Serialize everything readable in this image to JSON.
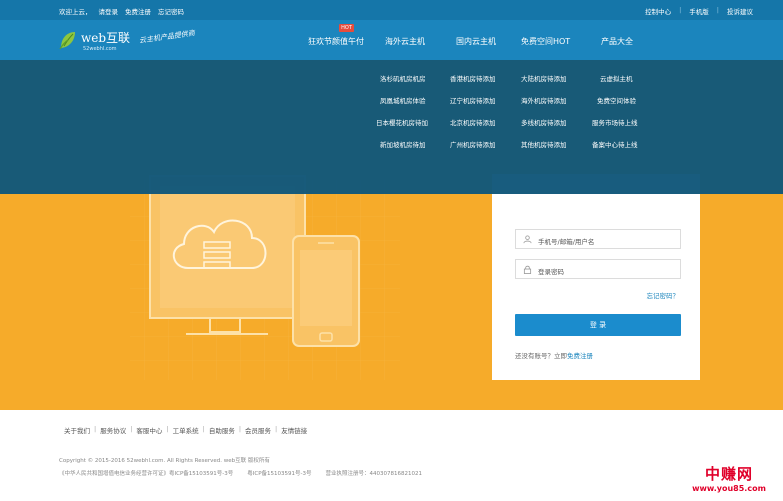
{
  "topbar": {
    "left_items": [
      "欢迎上云，",
      "请登录",
      "免费注册",
      "忘记密码"
    ],
    "right_items": [
      "控制中心",
      "手机版",
      "投诉建议"
    ]
  },
  "header": {
    "logo_main": "web互联",
    "logo_sub": "52webhl.com",
    "slogan": "云主机产品提供商",
    "nav": [
      {
        "label": "狂欢节颜值午付",
        "badge": "HOT"
      },
      {
        "label": "海外云主机"
      },
      {
        "label": "国内云主机"
      },
      {
        "label": "免费空间HOT"
      },
      {
        "label": "产品大全"
      }
    ]
  },
  "dropdown": {
    "col1": [
      "洛杉矶机房机房",
      "凤凰城机房体验",
      "日本樱花机房待加",
      "新加坡机房待加"
    ],
    "col2": [
      "香港机房待添加",
      "辽宁机房待添加",
      "北京机房待添加",
      "广州机房待添加"
    ],
    "col3": [
      "大陆机房待添加",
      "海外机房待添加",
      "多线机房待添加",
      "其他机房待添加"
    ],
    "col4": [
      "云虚拟主机",
      "免费空间体验",
      "服务市场待上线",
      "备案中心待上线"
    ]
  },
  "login": {
    "username_placeholder": "手机号/邮箱/用户名",
    "password_placeholder": "登录密码",
    "forgot": "忘记密码？",
    "submit": "登 录",
    "register_prefix": "还没有账号？立即",
    "register_link": "免费注册"
  },
  "footer": {
    "links": [
      "关于我们",
      "服务协议",
      "客服中心",
      "工单系统",
      "自助服务",
      "会员服务",
      "友情链接"
    ],
    "copyright": "Copyright © 2015-2016 52webhl.com. All Rights Reserved. web互联 版权所有",
    "licenses": [
      "《中华人民共和国增值电信业务经营许可证》粤ICP备15103591号-3号",
      "粤ICP备15103591号-3号",
      "营业执照注册号：440307816821021"
    ]
  },
  "watermark": {
    "cn": "中赚网",
    "url": "www.you85.com"
  },
  "colors": {
    "topbar": "#1576a9",
    "header": "#1b85bd",
    "hero": "#f6ab2a",
    "dropdown": "#11577a",
    "button": "#1b8ccd",
    "watermark": "#e0002a"
  }
}
